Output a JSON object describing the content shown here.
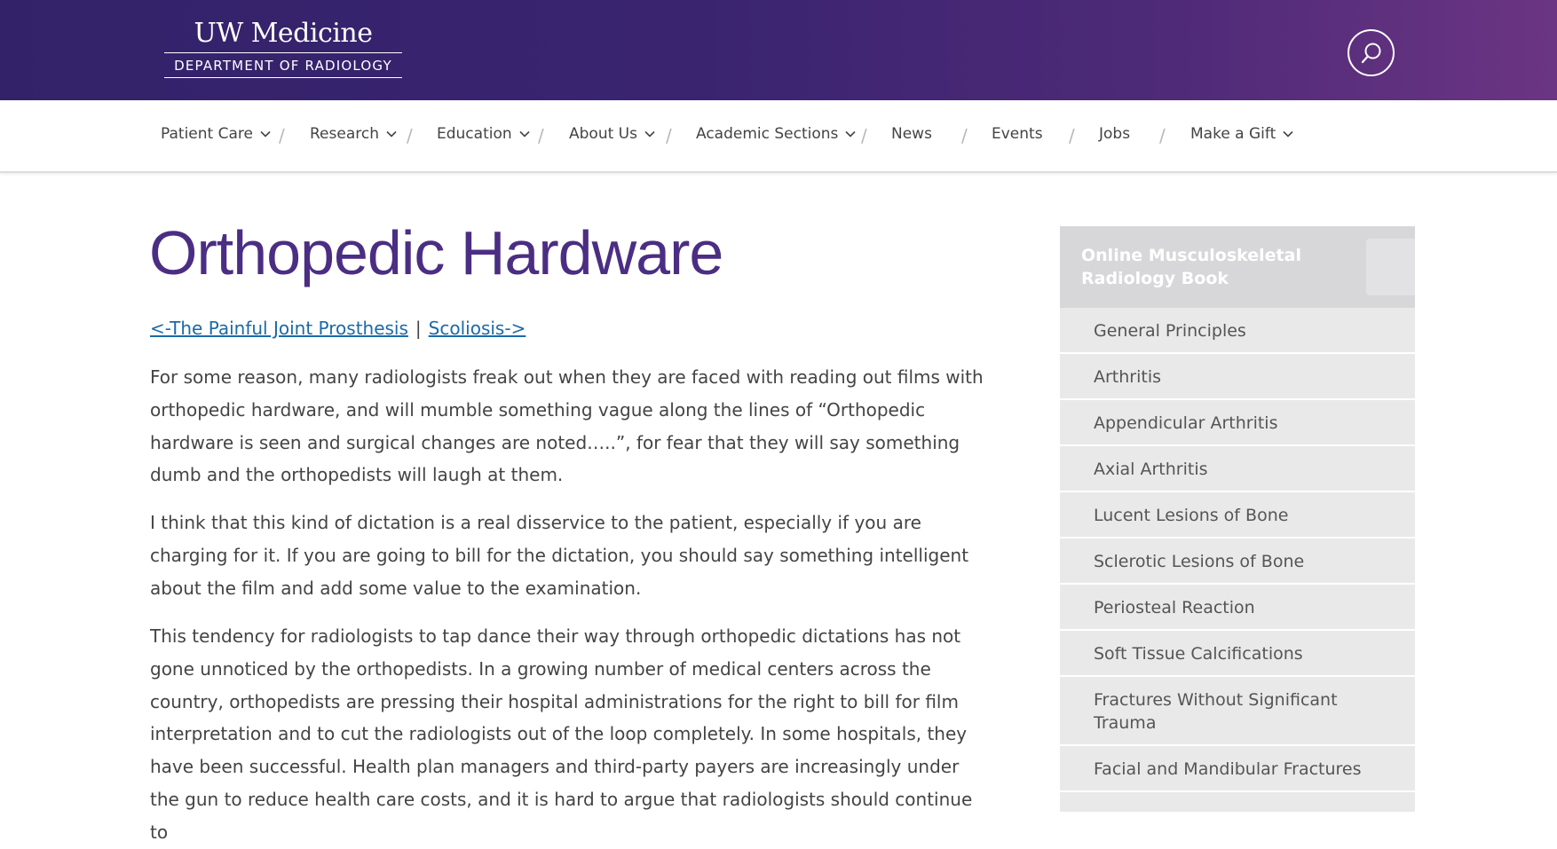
{
  "header": {
    "logo_main": "UW Medicine",
    "logo_sub": "DEPARTMENT OF RADIOLOGY",
    "search_icon": "search-icon"
  },
  "nav": {
    "items": [
      {
        "label": "Patient Care",
        "has_dropdown": true
      },
      {
        "label": "Research",
        "has_dropdown": true
      },
      {
        "label": "Education",
        "has_dropdown": true
      },
      {
        "label": "About Us",
        "has_dropdown": true
      },
      {
        "label": "Academic Sections",
        "has_dropdown": true
      },
      {
        "label": "News",
        "has_dropdown": false
      },
      {
        "label": "Events",
        "has_dropdown": false
      },
      {
        "label": "Jobs",
        "has_dropdown": false
      },
      {
        "label": "Make a Gift",
        "has_dropdown": true
      }
    ],
    "separator": "/"
  },
  "main": {
    "title": "Orthopedic Hardware",
    "prev_link": "<-The Painful Joint Prosthesis",
    "pipe": "|",
    "next_link": "Scoliosis->",
    "paragraphs": [
      "For some reason, many radiologists freak out when they are faced with reading out films with orthopedic hardware, and will mumble something vague along the lines of “Orthopedic hardware is seen and surgical changes are noted…..”, for fear that they will say something dumb and the orthopedists will laugh at them.",
      "I think that this kind of dictation is a real disservice to the patient, especially if you are charging for it. If you are going to bill for the dictation, you should say something intelligent about the film and add some value to the examination.",
      "This tendency for radiologists to tap dance their way through orthopedic dictations has not gone unnoticed by the orthopedists. In a growing number of medical centers across the country, orthopedists are pressing their hospital administrations for the right to bill for film interpretation and to cut the radiologists out of the loop completely. In some hospitals, they have been successful. Health plan managers and third-party payers are increasingly under the gun to reduce health care costs, and it is hard to argue that radiologists should continue to"
    ]
  },
  "sidebar": {
    "title": "Online Musculoskeletal Radiology Book",
    "items": [
      "General Principles",
      "Arthritis",
      "Appendicular Arthritis",
      "Axial Arthritis",
      "Lucent Lesions of Bone",
      "Sclerotic Lesions of Bone",
      "Periosteal Reaction",
      "Soft Tissue Calcifications",
      "Fractures Without Significant Trauma",
      "Facial and Mandibular Fractures"
    ]
  },
  "colors": {
    "header_gradient_start": "#33226a",
    "header_gradient_end": "#6b3583",
    "title_purple": "#4b2e83",
    "link_blue": "#1a6aa8",
    "sidebar_bg": "#e9e9e9"
  }
}
